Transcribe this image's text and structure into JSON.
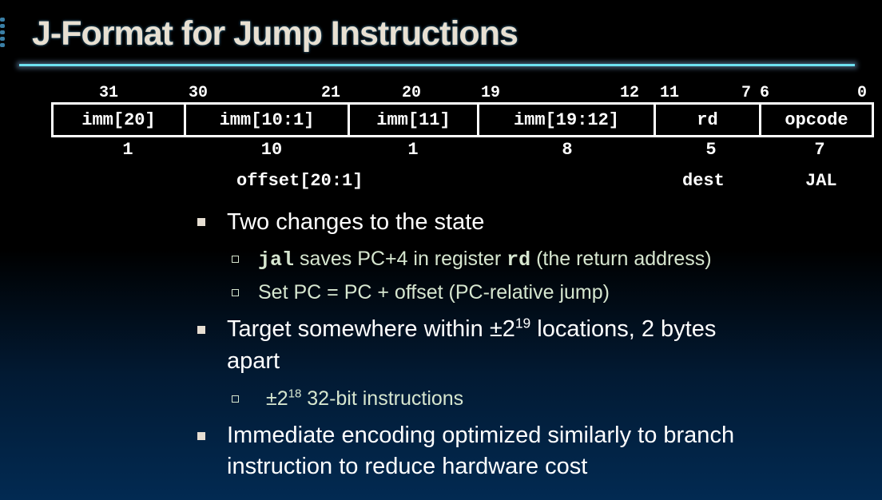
{
  "title": "J-Format for Jump Instructions",
  "format": {
    "bit_labels": [
      "31",
      "30",
      "21",
      "20",
      "19",
      "12",
      "11",
      "7",
      "6",
      "0"
    ],
    "fields": [
      "imm[20]",
      "imm[10:1]",
      "imm[11]",
      "imm[19:12]",
      "rd",
      "opcode"
    ],
    "widths": [
      "1",
      "10",
      "1",
      "8",
      "5",
      "7"
    ],
    "labels": {
      "offset": "offset[20:1]",
      "dest": "dest",
      "op": "JAL"
    }
  },
  "bullets": {
    "b1": "Two changes to the state",
    "b1_s1_code": "jal",
    "b1_s1_text": " saves PC+4 in register ",
    "b1_s1_code2": "rd",
    "b1_s1_tail": " (the return address)",
    "b1_s2": "Set PC = PC + offset (PC-relative jump)",
    "b2_pre": "Target somewhere within  ±2",
    "b2_exp": "19",
    "b2_post": " locations, 2 bytes",
    "b2_line2": "apart",
    "b2_s1_pre": "±2",
    "b2_s1_exp": "18",
    "b2_s1_post": " 32-bit instructions",
    "b3_l1": "Immediate encoding optimized similarly to branch",
    "b3_l2": "instruction to reduce hardware cost"
  },
  "colors": {
    "title": "#e8e0d2",
    "rule": "#6de0f0",
    "sub_text": "#d6e6cf"
  }
}
